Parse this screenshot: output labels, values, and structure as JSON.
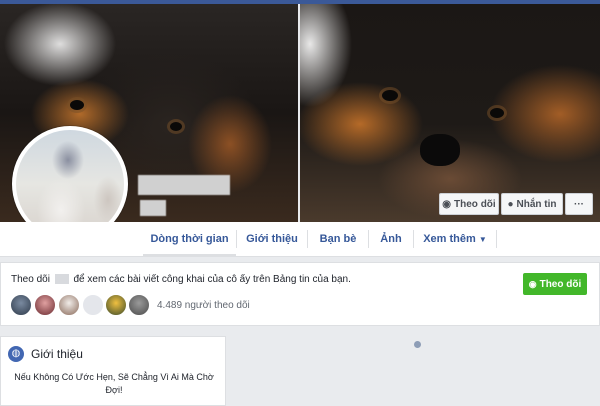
{
  "colors": {
    "brand": "#3b5998",
    "link": "#365899",
    "follow_green": "#42b72a",
    "page_bg": "#e9ebee"
  },
  "actions": {
    "follow_label": "Theo dõi",
    "message_label": "Nhắn tin",
    "more_label": "···"
  },
  "nav": {
    "items": [
      {
        "label": "Dòng thời gian"
      },
      {
        "label": "Giới thiệu"
      },
      {
        "label": "Bạn bè"
      },
      {
        "label": "Ảnh"
      },
      {
        "label": "Xem thêm",
        "icon": "caret-down-icon"
      }
    ]
  },
  "follow_prompt": {
    "prefix": "Theo dõi",
    "suffix": "để xem các bài viết công khai của cô ấy trên Bảng tin của bạn.",
    "button_label": "Theo dõi",
    "followers_text": "4.489 người theo dõi"
  },
  "intro": {
    "title": "Giới thiệu",
    "bio": "Nếu Không Có Ước Hẹn, Sẽ Chẳng Vì Ai Mà Chờ Đợi!"
  }
}
